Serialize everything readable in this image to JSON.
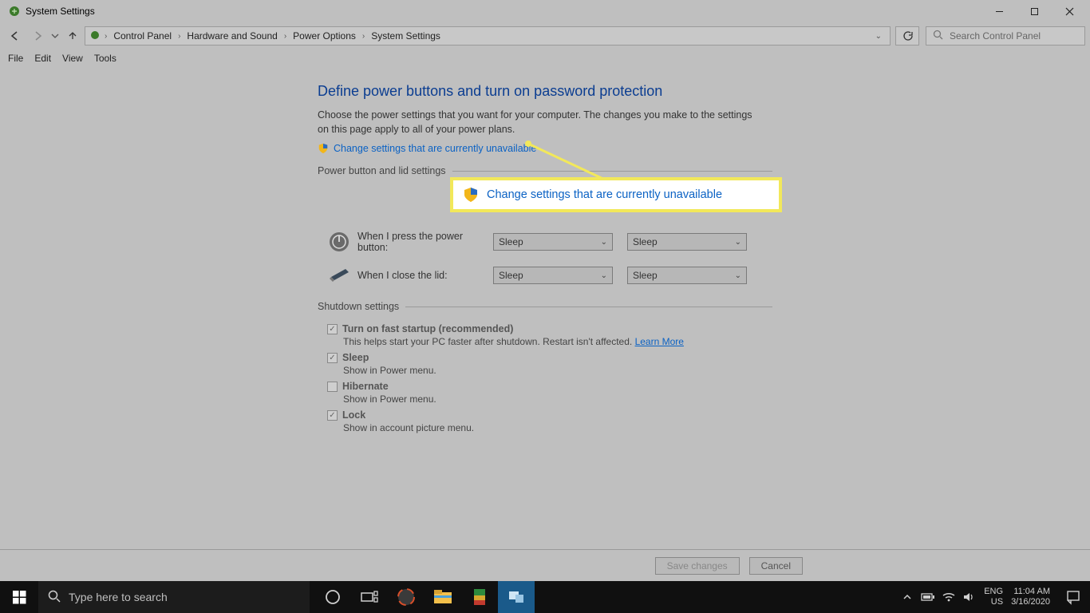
{
  "window": {
    "title": "System Settings"
  },
  "breadcrumb": {
    "items": [
      "Control Panel",
      "Hardware and Sound",
      "Power Options",
      "System Settings"
    ]
  },
  "search": {
    "placeholder": "Search Control Panel"
  },
  "menu": {
    "file": "File",
    "edit": "Edit",
    "view": "View",
    "tools": "Tools"
  },
  "main": {
    "heading": "Define power buttons and turn on password protection",
    "description": "Choose the power settings that you want for your computer. The changes you make to the settings on this page apply to all of your power plans.",
    "admin_link": "Change settings that are currently unavailable",
    "section1": "Power button and lid settings",
    "power_button_label": "When I press the power button:",
    "lid_label": "When I close the lid:",
    "dropdown_value": "Sleep",
    "section2": "Shutdown settings",
    "fast_startup": "Turn on fast startup (recommended)",
    "fast_startup_desc": "This helps start your PC faster after shutdown. Restart isn't affected. ",
    "learn_more": "Learn More",
    "sleep": "Sleep",
    "sleep_desc": "Show in Power menu.",
    "hibernate": "Hibernate",
    "hibernate_desc": "Show in Power menu.",
    "lock": "Lock",
    "lock_desc": "Show in account picture menu."
  },
  "callout": {
    "text": "Change settings that are currently unavailable"
  },
  "buttons": {
    "save": "Save changes",
    "cancel": "Cancel"
  },
  "taskbar": {
    "search": "Type here to search",
    "lang1": "ENG",
    "lang2": "US",
    "time": "11:04 AM",
    "date": "3/16/2020"
  }
}
